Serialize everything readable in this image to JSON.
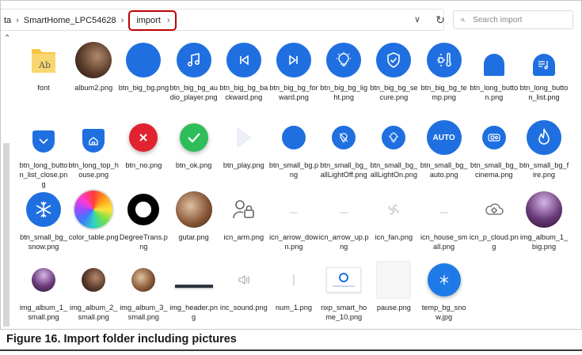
{
  "window": {
    "breadcrumb": [
      "ta",
      "SmartHome_LPC54628",
      "import"
    ],
    "search_placeholder": "Search import"
  },
  "files": [
    {
      "name": "font",
      "icon": "folder-icon"
    },
    {
      "name": "album2.png",
      "icon": "guitar-photo-icon"
    },
    {
      "name": "btn_big_bg.png",
      "icon": "blue-circle-icon"
    },
    {
      "name": "btn_big_bg_audio_player.png",
      "icon": "music-note-icon"
    },
    {
      "name": "btn_big_bg_backward.png",
      "icon": "skip-back-icon"
    },
    {
      "name": "btn_big_bg_forward.png",
      "icon": "skip-forward-icon"
    },
    {
      "name": "btn_big_bg_light.png",
      "icon": "light-bulb-icon"
    },
    {
      "name": "btn_big_bg_secure.png",
      "icon": "shield-check-icon"
    },
    {
      "name": "btn_big_bg_temp.png",
      "icon": "thermometer-icon"
    },
    {
      "name": "btn_long_button.png",
      "icon": "blue-arch-icon"
    },
    {
      "name": "btn_long_button_list.png",
      "icon": "playlist-icon"
    },
    {
      "name": "btn_long_button_list_close.png",
      "icon": "chevron-down-icon"
    },
    {
      "name": "btn_long_top_house.png",
      "icon": "house-icon"
    },
    {
      "name": "btn_no.png",
      "icon": "red-x-icon"
    },
    {
      "name": "btn_ok.png",
      "icon": "green-check-icon"
    },
    {
      "name": "btn_play.png",
      "icon": "play-triangle-icon"
    },
    {
      "name": "btn_small_bg.png",
      "icon": "small-blue-circle-icon"
    },
    {
      "name": "btn_small_bg_allLightOff.png",
      "icon": "light-off-icon"
    },
    {
      "name": "btn_small_bg_allLightOn.png",
      "icon": "light-on-icon"
    },
    {
      "name": "btn_small_bg_auto.png",
      "icon": "auto-icon",
      "text": "AUTO"
    },
    {
      "name": "btn_small_bg_cinema.png",
      "icon": "projector-icon"
    },
    {
      "name": "btn_small_bg_fire.png",
      "icon": "flame-icon"
    },
    {
      "name": "btn_small_bg_snow.png",
      "icon": "snowflake-icon"
    },
    {
      "name": "color_table.png",
      "icon": "color-wheel-icon"
    },
    {
      "name": "DegreeTrans.png",
      "icon": "black-ring-icon"
    },
    {
      "name": "gutar.png",
      "icon": "guitarist-photo-icon"
    },
    {
      "name": "icn_arm.png",
      "icon": "person-lock-icon"
    },
    {
      "name": "icn_arrow_down.png",
      "icon": "faint-arrow-icon"
    },
    {
      "name": "icn_arrow_up.png",
      "icon": "faint-arrow-icon"
    },
    {
      "name": "icn_fan.png",
      "icon": "fan-icon"
    },
    {
      "name": "icn_house_small.png",
      "icon": "faint-house-icon"
    },
    {
      "name": "icn_p_cloud.png",
      "icon": "cloud-gear-icon"
    },
    {
      "name": "img_album_1_big.png",
      "icon": "concert-photo-icon"
    },
    {
      "name": "img_album_1_small.png",
      "icon": "concert-photo-icon"
    },
    {
      "name": "img_album_2_small.png",
      "icon": "guitar-photo-icon"
    },
    {
      "name": "img_album_3_small.png",
      "icon": "guitarist-photo-icon"
    },
    {
      "name": "img_header.png",
      "icon": "header-bar-icon"
    },
    {
      "name": "inc_sound.png",
      "icon": "speaker-icon"
    },
    {
      "name": "num_1.png",
      "icon": "faint-digit-icon"
    },
    {
      "name": "nxp_smart_home_10.png",
      "icon": "screen-preview-icon"
    },
    {
      "name": "pause.png",
      "icon": "pause-blank-icon"
    },
    {
      "name": "temp_bg_snow.jpg",
      "icon": "snowflake-circle-icon"
    }
  ],
  "caption": "Figure 16.  Import folder including pictures"
}
